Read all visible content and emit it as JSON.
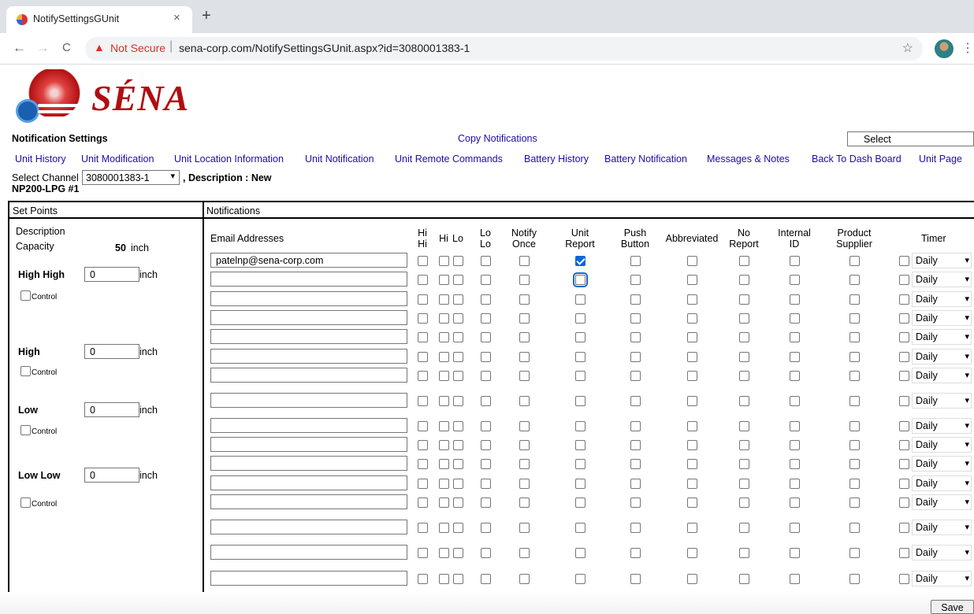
{
  "browser": {
    "tab_title": "NotifySettingsGUnit",
    "close": "×",
    "new_tab": "+",
    "back": "←",
    "forward": "→",
    "reload": "C",
    "warning_icon": "▲",
    "not_secure": "Not Secure",
    "separator": "|",
    "url": "sena-corp.com/NotifySettingsGUnit.aspx?id=3080001383-1",
    "star": "☆",
    "menu": "⋮"
  },
  "logo": {
    "text": "SÉNA"
  },
  "header": {
    "title": "Notification Settings",
    "copy_link": "Copy Notifications",
    "select_value": "Select"
  },
  "nav": [
    "Unit History",
    "Unit Modification",
    "Unit Location Information",
    "Unit Notification",
    "Unit Remote Commands",
    "Battery History",
    "Battery Notification",
    "Messages & Notes",
    "Back To Dash Board",
    "Unit Page"
  ],
  "channel": {
    "label": "Select Channel",
    "value": "3080001383-1",
    "arrow": "▾",
    "description_label": ", Description : New",
    "description_rest": "NP200-LPG #1"
  },
  "setpoints": {
    "heading": "Set Points",
    "description_label": "Description",
    "capacity_label": "Capacity",
    "capacity_value": "50",
    "capacity_unit": "inch",
    "levels": [
      {
        "label": "High High",
        "value": "0",
        "unit": "inch",
        "control": "Control"
      },
      {
        "label": "High",
        "value": "0",
        "unit": "inch",
        "control": "Control"
      },
      {
        "label": "Low",
        "value": "0",
        "unit": "inch",
        "control": "Control"
      },
      {
        "label": "Low Low",
        "value": "0",
        "unit": "inch",
        "control": "Control"
      }
    ]
  },
  "notifications": {
    "heading": "Notifications",
    "email_header": "Email Addresses",
    "columns": [
      [
        "Hi",
        "Hi"
      ],
      [
        "Hi"
      ],
      [
        "Lo"
      ],
      [
        "Lo",
        "Lo"
      ],
      [
        "Notify",
        "Once"
      ],
      [
        "Unit",
        "Report"
      ],
      [
        "Push",
        "Button"
      ],
      [
        "Abbreviated"
      ],
      [
        "No",
        "Report"
      ],
      [
        "Internal",
        "ID"
      ],
      [
        "Product",
        "Supplier"
      ]
    ],
    "timer_header": "Timer",
    "timer_option": "Daily",
    "rows": [
      {
        "email": "patelnp@sena-corp.com",
        "checked": [
          5
        ]
      },
      {
        "email": "",
        "checked": [],
        "focus": 5
      },
      {
        "email": "",
        "checked": []
      },
      {
        "email": "",
        "checked": []
      },
      {
        "email": "",
        "checked": []
      },
      {
        "email": "",
        "checked": []
      },
      {
        "email": "",
        "checked": []
      },
      {
        "email": "",
        "checked": []
      },
      {
        "email": "",
        "checked": []
      },
      {
        "email": "",
        "checked": []
      },
      {
        "email": "",
        "checked": []
      },
      {
        "email": "",
        "checked": []
      },
      {
        "email": "",
        "checked": []
      },
      {
        "email": "",
        "checked": []
      },
      {
        "email": "",
        "checked": []
      },
      {
        "email": "",
        "checked": []
      },
      {
        "email": "",
        "checked": []
      }
    ]
  },
  "save_label": "Save"
}
